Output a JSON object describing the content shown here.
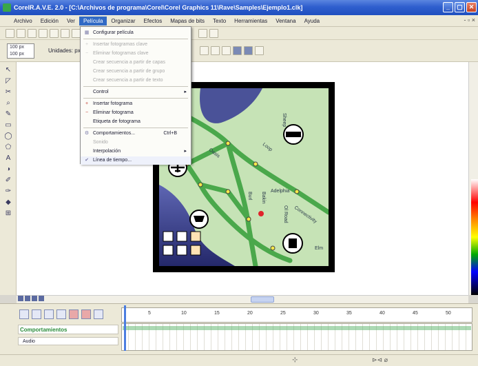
{
  "window": {
    "title": "CorelR.A.V.E. 2.0 - [C:\\Archivos de programa\\Corel\\Corel Graphics 11\\Rave\\Samples\\Ejemplo1.clk]",
    "min": "_",
    "max": "▢",
    "close": "✕"
  },
  "menubar": {
    "items": [
      "Archivo",
      "Edición",
      "Ver",
      "Película",
      "Organizar",
      "Efectos",
      "Mapas de bits",
      "Texto",
      "Herramientas",
      "Ventana",
      "Ayuda"
    ],
    "active_index": 3,
    "doc_controls": "- ▫ ×"
  },
  "toolbar2": {
    "size_w": "100 px",
    "size_h": "100 px",
    "units_label": "Unidades: px"
  },
  "dropdown": {
    "items": [
      {
        "label": "Configurar película",
        "enabled": true,
        "mark": "grid"
      },
      {
        "label": "Insertar fotogramas clave",
        "enabled": false
      },
      {
        "label": "Eliminar fotogramas clave",
        "enabled": false
      },
      {
        "label": "Crear secuencia a partir de capas",
        "enabled": false
      },
      {
        "label": "Crear secuencia a partir de grupo",
        "enabled": false
      },
      {
        "label": "Crear secuencia a partir de texto",
        "enabled": false
      },
      {
        "label": "Control",
        "enabled": true,
        "submenu": true
      },
      {
        "label": "Insertar fotograma",
        "enabled": true,
        "mark": "plus"
      },
      {
        "label": "Eliminar fotograma",
        "enabled": true,
        "mark": "minus"
      },
      {
        "label": "Etiqueta de fotograma",
        "enabled": true
      },
      {
        "label": "Comportamientos...",
        "enabled": true,
        "shortcut": "Ctrl+B"
      },
      {
        "label": "Sonido",
        "enabled": false
      },
      {
        "label": "Interpolación",
        "enabled": true,
        "submenu": true
      },
      {
        "label": "Línea de tiempo...",
        "enabled": true,
        "checked": true
      }
    ]
  },
  "map": {
    "labels": [
      "Adelphia",
      "Sheep",
      "Burl",
      "Bakin",
      "Ol Road",
      "Elm",
      "Oasis",
      "Loop",
      "Connectivity",
      "Park",
      "Ahh"
    ],
    "icons": [
      "airplane-icon",
      "shopping-cart-icon",
      "subway-icon",
      "transit-icon"
    ]
  },
  "timeline": {
    "ticks": [
      "5",
      "10",
      "15",
      "20",
      "25",
      "30",
      "35",
      "40",
      "45",
      "50"
    ],
    "layer_title": "Comportamientos",
    "object_label": "Audio"
  },
  "statusbar": {
    "left": "",
    "right": "⊳⊲  ⌀"
  },
  "colors": {
    "titlebar": "#2f5fce",
    "menu_active": "#316ac5",
    "map_land": "#c6e3b6",
    "map_water": "#3c3f8c",
    "map_road": "#4aa84b"
  }
}
